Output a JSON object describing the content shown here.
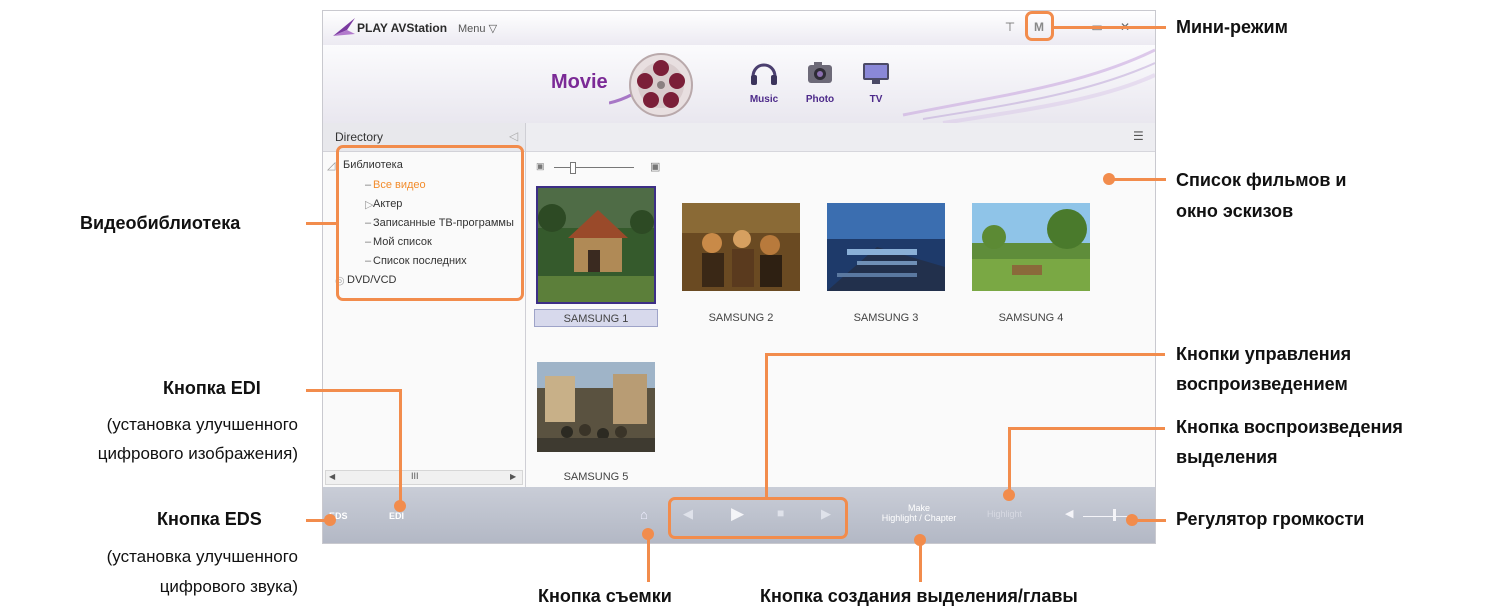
{
  "app": {
    "name": "PLAY AVStation",
    "menu_label": "Menu ▽",
    "mode_title": "Movie",
    "modes": [
      "Music",
      "Photo",
      "TV"
    ],
    "window_buttons": {
      "mini": "M",
      "restore": "⊤",
      "max": "▭",
      "close": "✕"
    }
  },
  "directory": {
    "title": "Directory",
    "tree": [
      "Библиотека",
      "Все видео",
      "Актер",
      "Записанные ТВ-программы",
      "Мой список",
      "Список последних",
      "DVD/VCD"
    ],
    "scroll_grip": "III"
  },
  "videos": [
    "SAMSUNG 1",
    "SAMSUNG 2",
    "SAMSUNG 3",
    "SAMSUNG 4",
    "SAMSUNG 5"
  ],
  "controls": {
    "eds": "EDS",
    "edi": "EDI",
    "make_line1": "Make",
    "make_line2": "Highlight / Chapter",
    "highlight": "Highlight"
  },
  "annotations": {
    "mini_mode": "Мини-режим",
    "movie_list_1": "Список фильмов и",
    "movie_list_2": "окно эскизов",
    "library": "Видеобиблиотека",
    "playback_1": "Кнопки управления",
    "playback_2": "воспроизведением",
    "highlight_play_1": "Кнопка воспроизведения",
    "highlight_play_2": "выделения",
    "edi_title": "Кнопка EDI",
    "edi_desc_1": "(установка улучшенного",
    "edi_desc_2": "цифрового изображения)",
    "eds_title": "Кнопка EDS",
    "eds_desc_1": "(установка улучшенного",
    "eds_desc_2": "цифрового звука)",
    "volume": "Регулятор громкости",
    "capture": "Кнопка съемки",
    "make_chapter": "Кнопка создания выделения/главы"
  },
  "colors": {
    "accent": "#f28c4c",
    "movie": "#7b2a96",
    "selection": "#3d2f86"
  }
}
